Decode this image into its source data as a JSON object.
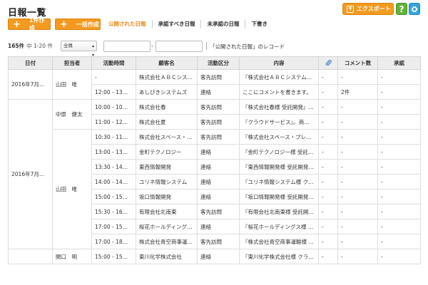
{
  "page_title": "日報一覧",
  "header_buttons": {
    "export_label": "エクスポート",
    "help_label": "?"
  },
  "actions": {
    "create_one_label": "1件作成",
    "create_bulk_label": "一括作成"
  },
  "tabs": [
    {
      "label": "公開された日報",
      "active": true
    },
    {
      "label": "承認すべき日報",
      "active": false
    },
    {
      "label": "未承認の日報",
      "active": false
    },
    {
      "label": "下書き",
      "active": false
    }
  ],
  "filter": {
    "count": "165件",
    "range": "中 1-20 件",
    "select_value": "全員",
    "dash": "-",
    "record_text": "「公開された日報」のレコード"
  },
  "table": {
    "headers": [
      "日付",
      "担当者",
      "活動時間",
      "顧客名",
      "活動区分",
      "内容",
      "",
      "コメント数",
      "承認"
    ],
    "groups": [
      {
        "date": "2016年7月…",
        "persons": [
          {
            "name": "山田　唯",
            "rows": [
              [
                "-",
                "株式会社ＡＢＣシス…",
                "客先訪問",
                "『株式会社ＡＢＣシステム…",
                "-",
                "-",
                "-"
              ],
              [
                "12:00 - 13…",
                "あしびきシステムズ",
                "連絡",
                "ここにコメントを書きます。",
                "-",
                "2件",
                "-"
              ]
            ]
          }
        ]
      },
      {
        "date": "2016年7月…",
        "persons": [
          {
            "name": "中原　健太",
            "rows": [
              [
                "10:00 - 10…",
                "株式会社春",
                "客先訪問",
                "『株式会社春様 受託開発』…",
                "-",
                "-",
                "-"
              ],
              [
                "11:00 - 12…",
                "株式会社夏",
                "客先訪問",
                "『クラウドサービス』。商…",
                "-",
                "-",
                "-"
              ]
            ]
          },
          {
            "name": "山田　唯",
            "rows": [
              [
                "10:30 - 11…",
                "株式会社スペース・…",
                "客先訪問",
                "『株式会社スペース・プレ…",
                "-",
                "-",
                "-"
              ],
              [
                "13:00 - 13…",
                "金町テクノロジー",
                "連絡",
                "『金町テクノロジー様 受託…",
                "-",
                "-",
                "-"
              ],
              [
                "13:30 - 14…",
                "東西情報開発",
                "連絡",
                "『東西情報開発様 受託開発…",
                "-",
                "-",
                "-"
              ],
              [
                "14:00 - 14…",
                "ユリネ情報システム",
                "連絡",
                "『ユリネ情報システム様 ク…",
                "-",
                "-",
                "-"
              ],
              [
                "15:00 - 15…",
                "坂口情報開発",
                "連絡",
                "『坂口情報開発様 受託開発…",
                "-",
                "-",
                "-"
              ],
              [
                "15:30 - 16…",
                "有限会社北南東",
                "客先訪問",
                "『有限会社北南東様 受託開…",
                "-",
                "-",
                "-"
              ],
              [
                "17:00 - 15…",
                "桜花ホールディング…",
                "連絡",
                "『桜花ホールディングス様 …",
                "-",
                "-",
                "-"
              ],
              [
                "17:00 - 18…",
                "株式会社青空商事運…",
                "客先訪問",
                "『株式会社青空商事運輸様 …",
                "-",
                "-",
                "-"
              ]
            ]
          }
        ]
      },
      {
        "date": "",
        "persons": [
          {
            "name": "関口　明",
            "rows": [
              [
                "15:00 - 15…",
                "東川化学株式会社",
                "連絡",
                "『東川化学株式会社様 クラ…",
                "-",
                "-",
                "-"
              ]
            ]
          }
        ]
      }
    ]
  },
  "colors": {
    "accent_orange": "#f39a1f",
    "help_green": "#64b13a",
    "gear_blue": "#33a3d9"
  }
}
